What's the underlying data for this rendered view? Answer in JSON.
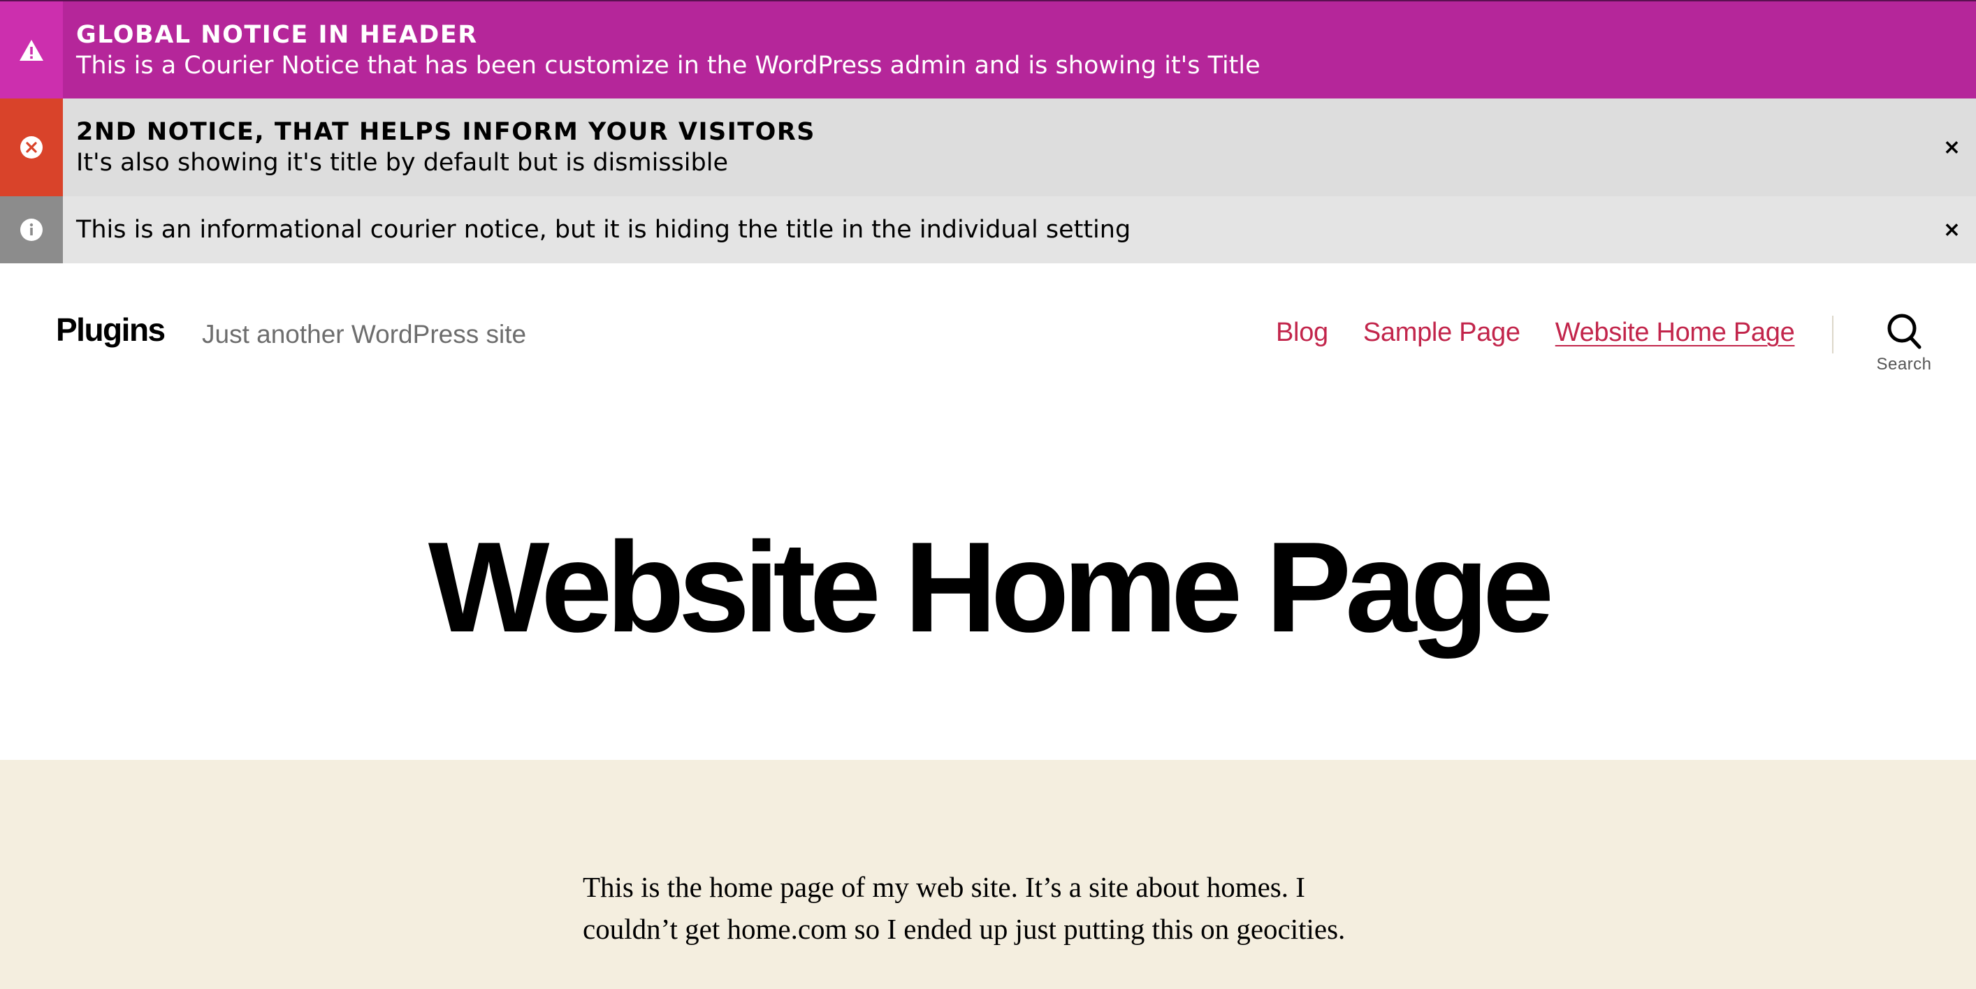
{
  "notices": [
    {
      "title": "GLOBAL NOTICE IN HEADER",
      "text": "This is a Courier Notice that has been customize in the WordPress admin and is showing it's Title",
      "icon": "warning-icon",
      "color": "#b5269a"
    },
    {
      "title": "2ND NOTICE, THAT HELPS INFORM YOUR VISITORS",
      "text": "It's also showing it's title by default but is dismissible",
      "icon": "error-icon",
      "close": "×",
      "color": "#d9432a"
    },
    {
      "text": "This is an informational courier notice, but it is hiding the title in the individual setting",
      "icon": "info-icon",
      "close": "×",
      "color": "#8c8c8c"
    }
  ],
  "header": {
    "site_title": "Plugins",
    "site_description": "Just another WordPress site",
    "nav": [
      "Blog",
      "Sample Page",
      "Website Home Page"
    ],
    "current_nav": "Website Home Page",
    "search_label": "Search",
    "accent_color": "#c2254b"
  },
  "page": {
    "title": "Website Home Page",
    "content": "This is the home page of my web site. It’s a site about homes. I couldn’t get home.com so I ended up just putting this on geocities."
  }
}
